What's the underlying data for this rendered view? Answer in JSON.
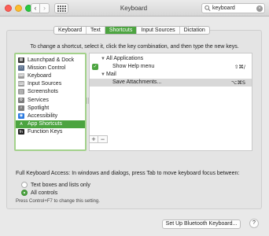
{
  "window": {
    "title": "Keyboard",
    "back_glyph": "‹",
    "forward_glyph": "›"
  },
  "search": {
    "value": "keyboard",
    "clear_glyph": "×"
  },
  "tabs": [
    {
      "label": "Keyboard",
      "active": false
    },
    {
      "label": "Text",
      "active": false
    },
    {
      "label": "Shortcuts",
      "active": true
    },
    {
      "label": "Input Sources",
      "active": false
    },
    {
      "label": "Dictation",
      "active": false
    }
  ],
  "instruction": "To change a shortcut, select it, click the key combination, and then type the new keys.",
  "categories": [
    {
      "label": "Launchpad & Dock",
      "icon": "launchpad-icon",
      "color": "#3a3a3a",
      "selected": false
    },
    {
      "label": "Mission Control",
      "icon": "mission-control-icon",
      "color": "#5a6f8c",
      "selected": false
    },
    {
      "label": "Keyboard",
      "icon": "keyboard-icon",
      "color": "#9a9a9a",
      "selected": false
    },
    {
      "label": "Input Sources",
      "icon": "input-sources-icon",
      "color": "#9a9a9a",
      "selected": false
    },
    {
      "label": "Screenshots",
      "icon": "screenshots-icon",
      "color": "#9a9a9a",
      "selected": false
    },
    {
      "label": "Services",
      "icon": "gear-icon",
      "color": "#7d7d7d",
      "selected": false
    },
    {
      "label": "Spotlight",
      "icon": "spotlight-icon",
      "color": "#7d7d7d",
      "selected": false
    },
    {
      "label": "Accessibility",
      "icon": "accessibility-icon",
      "color": "#2d7be0",
      "selected": false
    },
    {
      "label": "App Shortcuts",
      "icon": "app-shortcuts-icon",
      "color": "#4ca440",
      "selected": true
    },
    {
      "label": "Function Keys",
      "icon": "function-keys-icon",
      "color": "#222222",
      "selected": false
    }
  ],
  "shortcuts": [
    {
      "label": "All Applications",
      "indent": 0,
      "disclosure": "▼",
      "checked": false,
      "keys": "",
      "selected": false
    },
    {
      "label": "Show Help menu",
      "indent": 1,
      "disclosure": "",
      "checked": true,
      "keys": "⇧⌘/",
      "selected": false
    },
    {
      "label": "Mail",
      "indent": 0,
      "disclosure": "▼",
      "checked": false,
      "keys": "",
      "selected": false
    },
    {
      "label": "Save Attachments...",
      "indent": 1,
      "disclosure": "",
      "checked": false,
      "keys": "⌥⌘S",
      "selected": true
    }
  ],
  "controls": {
    "add_label": "+",
    "remove_label": "−"
  },
  "full_keyboard_access": {
    "label": "Full Keyboard Access: In windows and dialogs, press Tab to move keyboard focus between:",
    "options": [
      {
        "label": "Text boxes and lists only",
        "selected": false
      },
      {
        "label": "All controls",
        "selected": true
      }
    ],
    "hint": "Press Control+F7 to change this setting."
  },
  "footer": {
    "bluetooth_button": "Set Up Bluetooth Keyboard...",
    "help_button": "?"
  },
  "colors": {
    "accent": "#4ca440"
  }
}
